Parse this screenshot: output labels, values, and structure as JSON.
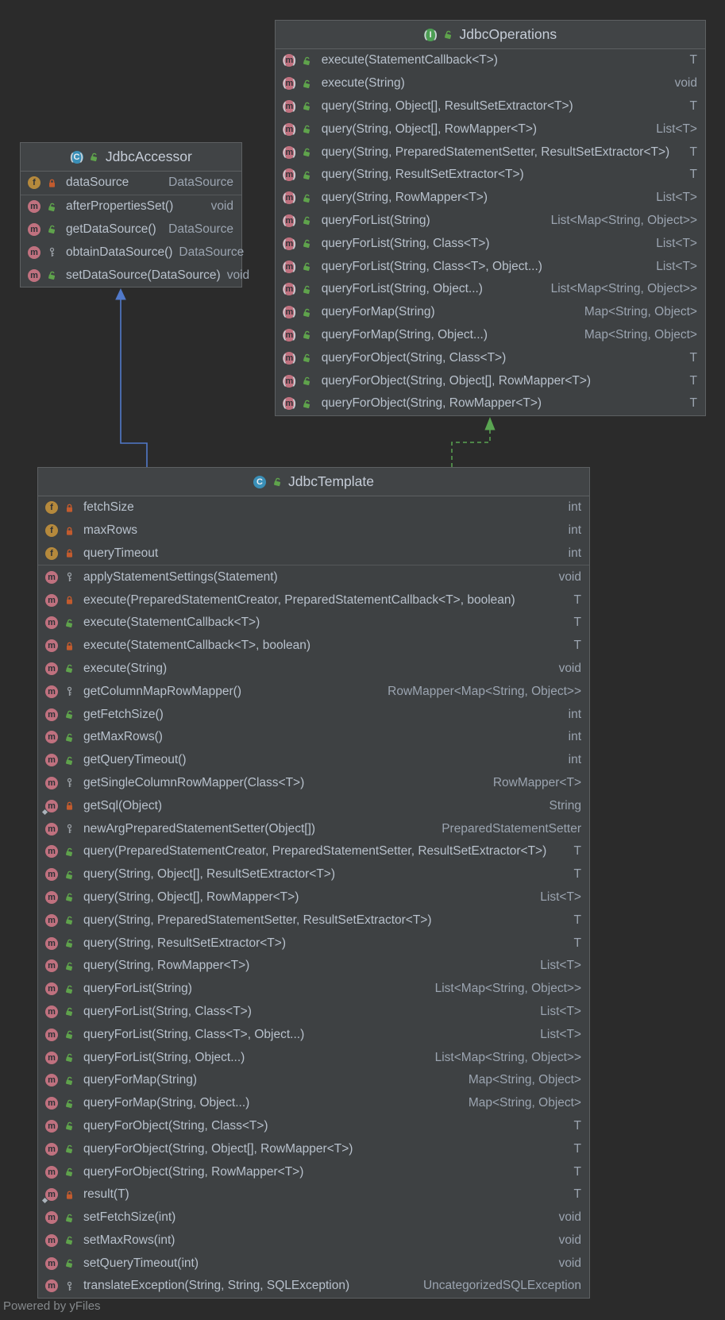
{
  "diagram_type": "uml-class-diagram",
  "footer": {
    "text": "Powered by yFiles"
  },
  "icons": {
    "method_letter": "m",
    "field_letter": "f",
    "class_letter": "C",
    "interface_letter": "I"
  },
  "colors": {
    "canvas": "#2b2b2b",
    "boxfill": "#3e4143",
    "headfill": "#414446",
    "border": "#5d6062",
    "name": "#b8c1cc",
    "type": "#9ba4b0",
    "title": "#c6cdd8",
    "method": "#c0717f",
    "field": "#b5893c",
    "classicon": "#3a8fb7",
    "interfaceicon": "#4d9e54",
    "public": "#5fa34c",
    "private": "#c25b2e",
    "protected": "#9aa0a6",
    "static": "#aab3bb",
    "extends": "#5179c9",
    "implements": "#5aa552",
    "footer": "#85898c"
  },
  "edges": [
    {
      "type": "extends",
      "from": "JdbcTemplate",
      "to": "JdbcAccessor",
      "style": "solid",
      "color": "#5179c9"
    },
    {
      "type": "implements",
      "from": "JdbcTemplate",
      "to": "JdbcOperations",
      "style": "dashed",
      "color": "#5aa552"
    }
  ],
  "classes": [
    {
      "id": "ops",
      "title": "JdbcOperations",
      "kind": "interface",
      "abstract": true,
      "visibility": "public",
      "fields": [],
      "methods": [
        {
          "name": "execute(StatementCallback<T>)",
          "type": "T",
          "visibility": "public",
          "abstract": true
        },
        {
          "name": "execute(String)",
          "type": "void",
          "visibility": "public",
          "abstract": true
        },
        {
          "name": "query(String, Object[], ResultSetExtractor<T>)",
          "type": "T",
          "visibility": "public",
          "abstract": true
        },
        {
          "name": "query(String, Object[], RowMapper<T>)",
          "type": "List<T>",
          "visibility": "public",
          "abstract": true
        },
        {
          "name": "query(String, PreparedStatementSetter, ResultSetExtractor<T>)",
          "type": "T",
          "visibility": "public",
          "abstract": true
        },
        {
          "name": "query(String, ResultSetExtractor<T>)",
          "type": "T",
          "visibility": "public",
          "abstract": true
        },
        {
          "name": "query(String, RowMapper<T>)",
          "type": "List<T>",
          "visibility": "public",
          "abstract": true
        },
        {
          "name": "queryForList(String)",
          "type": "List<Map<String, Object>>",
          "visibility": "public",
          "abstract": true
        },
        {
          "name": "queryForList(String, Class<T>)",
          "type": "List<T>",
          "visibility": "public",
          "abstract": true
        },
        {
          "name": "queryForList(String, Class<T>, Object...)",
          "type": "List<T>",
          "visibility": "public",
          "abstract": true
        },
        {
          "name": "queryForList(String, Object...)",
          "type": "List<Map<String, Object>>",
          "visibility": "public",
          "abstract": true
        },
        {
          "name": "queryForMap(String)",
          "type": "Map<String, Object>",
          "visibility": "public",
          "abstract": true
        },
        {
          "name": "queryForMap(String, Object...)",
          "type": "Map<String, Object>",
          "visibility": "public",
          "abstract": true
        },
        {
          "name": "queryForObject(String, Class<T>)",
          "type": "T",
          "visibility": "public",
          "abstract": true
        },
        {
          "name": "queryForObject(String, Object[], RowMapper<T>)",
          "type": "T",
          "visibility": "public",
          "abstract": true
        },
        {
          "name": "queryForObject(String, RowMapper<T>)",
          "type": "T",
          "visibility": "public",
          "abstract": true
        }
      ]
    },
    {
      "id": "acc",
      "title": "JdbcAccessor",
      "kind": "class",
      "abstract": true,
      "visibility": "public",
      "fields": [
        {
          "name": "dataSource",
          "type": "DataSource",
          "visibility": "private"
        }
      ],
      "methods": [
        {
          "name": "afterPropertiesSet()",
          "type": "void",
          "visibility": "public"
        },
        {
          "name": "getDataSource()",
          "type": "DataSource",
          "visibility": "public"
        },
        {
          "name": "obtainDataSource()",
          "type": "DataSource",
          "visibility": "protected"
        },
        {
          "name": "setDataSource(DataSource)",
          "type": "void",
          "visibility": "public"
        }
      ]
    },
    {
      "id": "tpl",
      "title": "JdbcTemplate",
      "kind": "class",
      "abstract": false,
      "visibility": "public",
      "fields": [
        {
          "name": "fetchSize",
          "type": "int",
          "visibility": "private"
        },
        {
          "name": "maxRows",
          "type": "int",
          "visibility": "private"
        },
        {
          "name": "queryTimeout",
          "type": "int",
          "visibility": "private"
        }
      ],
      "methods": [
        {
          "name": "applyStatementSettings(Statement)",
          "type": "void",
          "visibility": "protected"
        },
        {
          "name": "execute(PreparedStatementCreator, PreparedStatementCallback<T>, boolean)",
          "type": "T",
          "visibility": "private"
        },
        {
          "name": "execute(StatementCallback<T>)",
          "type": "T",
          "visibility": "public"
        },
        {
          "name": "execute(StatementCallback<T>, boolean)",
          "type": "T",
          "visibility": "private"
        },
        {
          "name": "execute(String)",
          "type": "void",
          "visibility": "public"
        },
        {
          "name": "getColumnMapRowMapper()",
          "type": "RowMapper<Map<String, Object>>",
          "visibility": "protected"
        },
        {
          "name": "getFetchSize()",
          "type": "int",
          "visibility": "public"
        },
        {
          "name": "getMaxRows()",
          "type": "int",
          "visibility": "public"
        },
        {
          "name": "getQueryTimeout()",
          "type": "int",
          "visibility": "public"
        },
        {
          "name": "getSingleColumnRowMapper(Class<T>)",
          "type": "RowMapper<T>",
          "visibility": "protected"
        },
        {
          "name": "getSql(Object)",
          "type": "String",
          "visibility": "private",
          "static": true
        },
        {
          "name": "newArgPreparedStatementSetter(Object[])",
          "type": "PreparedStatementSetter",
          "visibility": "protected"
        },
        {
          "name": "query(PreparedStatementCreator, PreparedStatementSetter, ResultSetExtractor<T>)",
          "type": "T",
          "visibility": "public"
        },
        {
          "name": "query(String, Object[], ResultSetExtractor<T>)",
          "type": "T",
          "visibility": "public"
        },
        {
          "name": "query(String, Object[], RowMapper<T>)",
          "type": "List<T>",
          "visibility": "public"
        },
        {
          "name": "query(String, PreparedStatementSetter, ResultSetExtractor<T>)",
          "type": "T",
          "visibility": "public"
        },
        {
          "name": "query(String, ResultSetExtractor<T>)",
          "type": "T",
          "visibility": "public"
        },
        {
          "name": "query(String, RowMapper<T>)",
          "type": "List<T>",
          "visibility": "public"
        },
        {
          "name": "queryForList(String)",
          "type": "List<Map<String, Object>>",
          "visibility": "public"
        },
        {
          "name": "queryForList(String, Class<T>)",
          "type": "List<T>",
          "visibility": "public"
        },
        {
          "name": "queryForList(String, Class<T>, Object...)",
          "type": "List<T>",
          "visibility": "public"
        },
        {
          "name": "queryForList(String, Object...)",
          "type": "List<Map<String, Object>>",
          "visibility": "public"
        },
        {
          "name": "queryForMap(String)",
          "type": "Map<String, Object>",
          "visibility": "public"
        },
        {
          "name": "queryForMap(String, Object...)",
          "type": "Map<String, Object>",
          "visibility": "public"
        },
        {
          "name": "queryForObject(String, Class<T>)",
          "type": "T",
          "visibility": "public"
        },
        {
          "name": "queryForObject(String, Object[], RowMapper<T>)",
          "type": "T",
          "visibility": "public"
        },
        {
          "name": "queryForObject(String, RowMapper<T>)",
          "type": "T",
          "visibility": "public"
        },
        {
          "name": "result(T)",
          "type": "T",
          "visibility": "private",
          "static": true
        },
        {
          "name": "setFetchSize(int)",
          "type": "void",
          "visibility": "public"
        },
        {
          "name": "setMaxRows(int)",
          "type": "void",
          "visibility": "public"
        },
        {
          "name": "setQueryTimeout(int)",
          "type": "void",
          "visibility": "public"
        },
        {
          "name": "translateException(String, String, SQLException)",
          "type": "UncategorizedSQLException",
          "visibility": "protected"
        }
      ]
    }
  ]
}
